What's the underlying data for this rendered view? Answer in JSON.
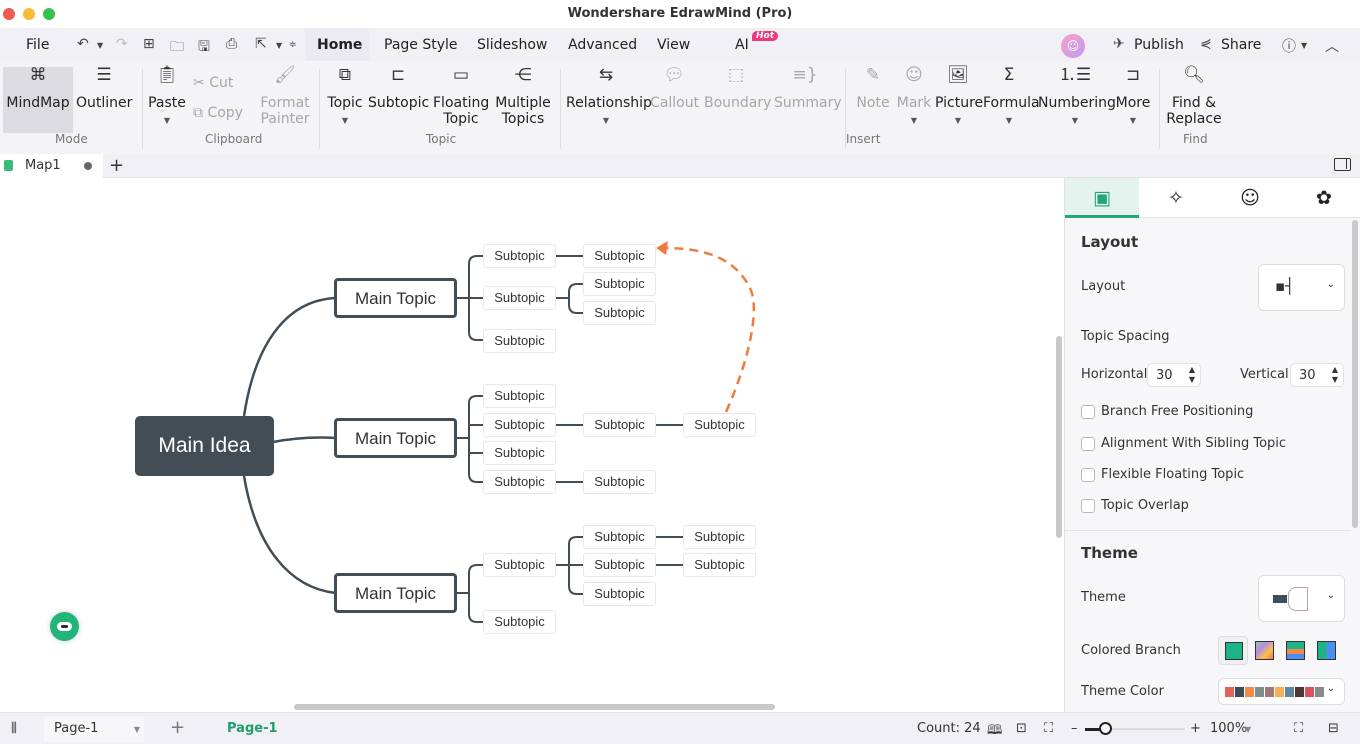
{
  "app": {
    "title": "Wondershare EdrawMind (Pro)"
  },
  "menu": {
    "file": "File",
    "tabs": [
      "Home",
      "Page Style",
      "Slideshow",
      "Advanced",
      "View",
      "AI"
    ],
    "ai_badge": "Hot",
    "publish": "Publish",
    "share": "Share"
  },
  "ribbon": {
    "mode": {
      "label": "Mode",
      "mindmap": "MindMap",
      "outliner": "Outliner"
    },
    "clipboard": {
      "label": "Clipboard",
      "paste": "Paste",
      "cut": "Cut",
      "copy": "Copy",
      "format_painter_1": "Format",
      "format_painter_2": "Painter"
    },
    "topic": {
      "label": "Topic",
      "topic": "Topic",
      "subtopic": "Subtopic",
      "floating_1": "Floating",
      "floating_2": "Topic",
      "multiple_1": "Multiple",
      "multiple_2": "Topics"
    },
    "insert": {
      "label": "Insert",
      "relationship": "Relationship",
      "callout": "Callout",
      "boundary": "Boundary",
      "summary": "Summary",
      "note": "Note",
      "mark": "Mark",
      "picture": "Picture",
      "formula": "Formula",
      "numbering": "Numbering",
      "more": "More"
    },
    "find": {
      "label": "Find",
      "find_1": "Find &",
      "find_2": "Replace"
    }
  },
  "doc_tab": {
    "name": "Map1"
  },
  "mindmap": {
    "root": "Main Idea",
    "main_topics": [
      "Main Topic",
      "Main Topic",
      "Main Topic"
    ],
    "subtopic_label": "Subtopic"
  },
  "panel": {
    "layout_header": "Layout",
    "layout_label": "Layout",
    "topic_spacing": "Topic Spacing",
    "horizontal_label": "Horizontal",
    "horizontal_value": "30",
    "vertical_label": "Vertical",
    "vertical_value": "30",
    "checkboxes": [
      "Branch Free Positioning",
      "Alignment With Sibling Topic",
      "Flexible Floating Topic",
      "Topic Overlap"
    ],
    "theme_header": "Theme",
    "theme_label": "Theme",
    "colored_branch_label": "Colored Branch",
    "theme_color_label": "Theme Color",
    "theme_colors": [
      "#e8605a",
      "#3e4a54",
      "#f58a46",
      "#7d8e8e",
      "#a07a7a",
      "#f9ae52",
      "#6088a0",
      "#4d3535",
      "#d9525e",
      "#8a8a8a"
    ]
  },
  "status": {
    "page_select": "Page-1",
    "page_tab": "Page-1",
    "count": "Count: 24",
    "zoom": "100%",
    "zoom_fraction": 0.2
  }
}
